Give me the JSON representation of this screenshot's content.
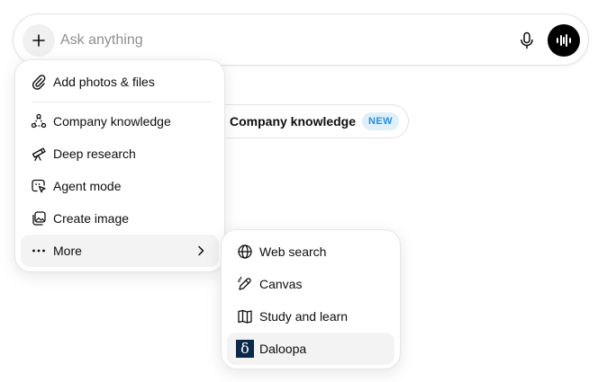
{
  "composer": {
    "placeholder": "Ask anything",
    "icons": {
      "plus": "plus-icon",
      "mic": "microphone-icon",
      "voice": "voice-waveform-icon"
    }
  },
  "chip": {
    "label": "Company knowledge",
    "badge": "NEW"
  },
  "menu": {
    "items": [
      {
        "label": "Add photos & files",
        "icon": "paperclip-icon"
      },
      {
        "label": "Company knowledge",
        "icon": "company-knowledge-icon"
      },
      {
        "label": "Deep research",
        "icon": "telescope-icon"
      },
      {
        "label": "Agent mode",
        "icon": "agent-cursor-icon"
      },
      {
        "label": "Create image",
        "icon": "image-icon"
      },
      {
        "label": "More",
        "icon": "ellipsis-icon",
        "submenu": true,
        "active": true
      }
    ]
  },
  "submenu": {
    "items": [
      {
        "label": "Web search",
        "icon": "globe-icon"
      },
      {
        "label": "Canvas",
        "icon": "pencil-icon"
      },
      {
        "label": "Study and learn",
        "icon": "book-icon"
      },
      {
        "label": "Daloopa",
        "icon": "daloopa-logo-icon",
        "logo_glyph": "δ",
        "active": true
      }
    ]
  },
  "colors": {
    "badge_bg": "#dff0fb",
    "badge_text": "#2a8fd8",
    "daloopa_bg": "#0b2a4a"
  }
}
